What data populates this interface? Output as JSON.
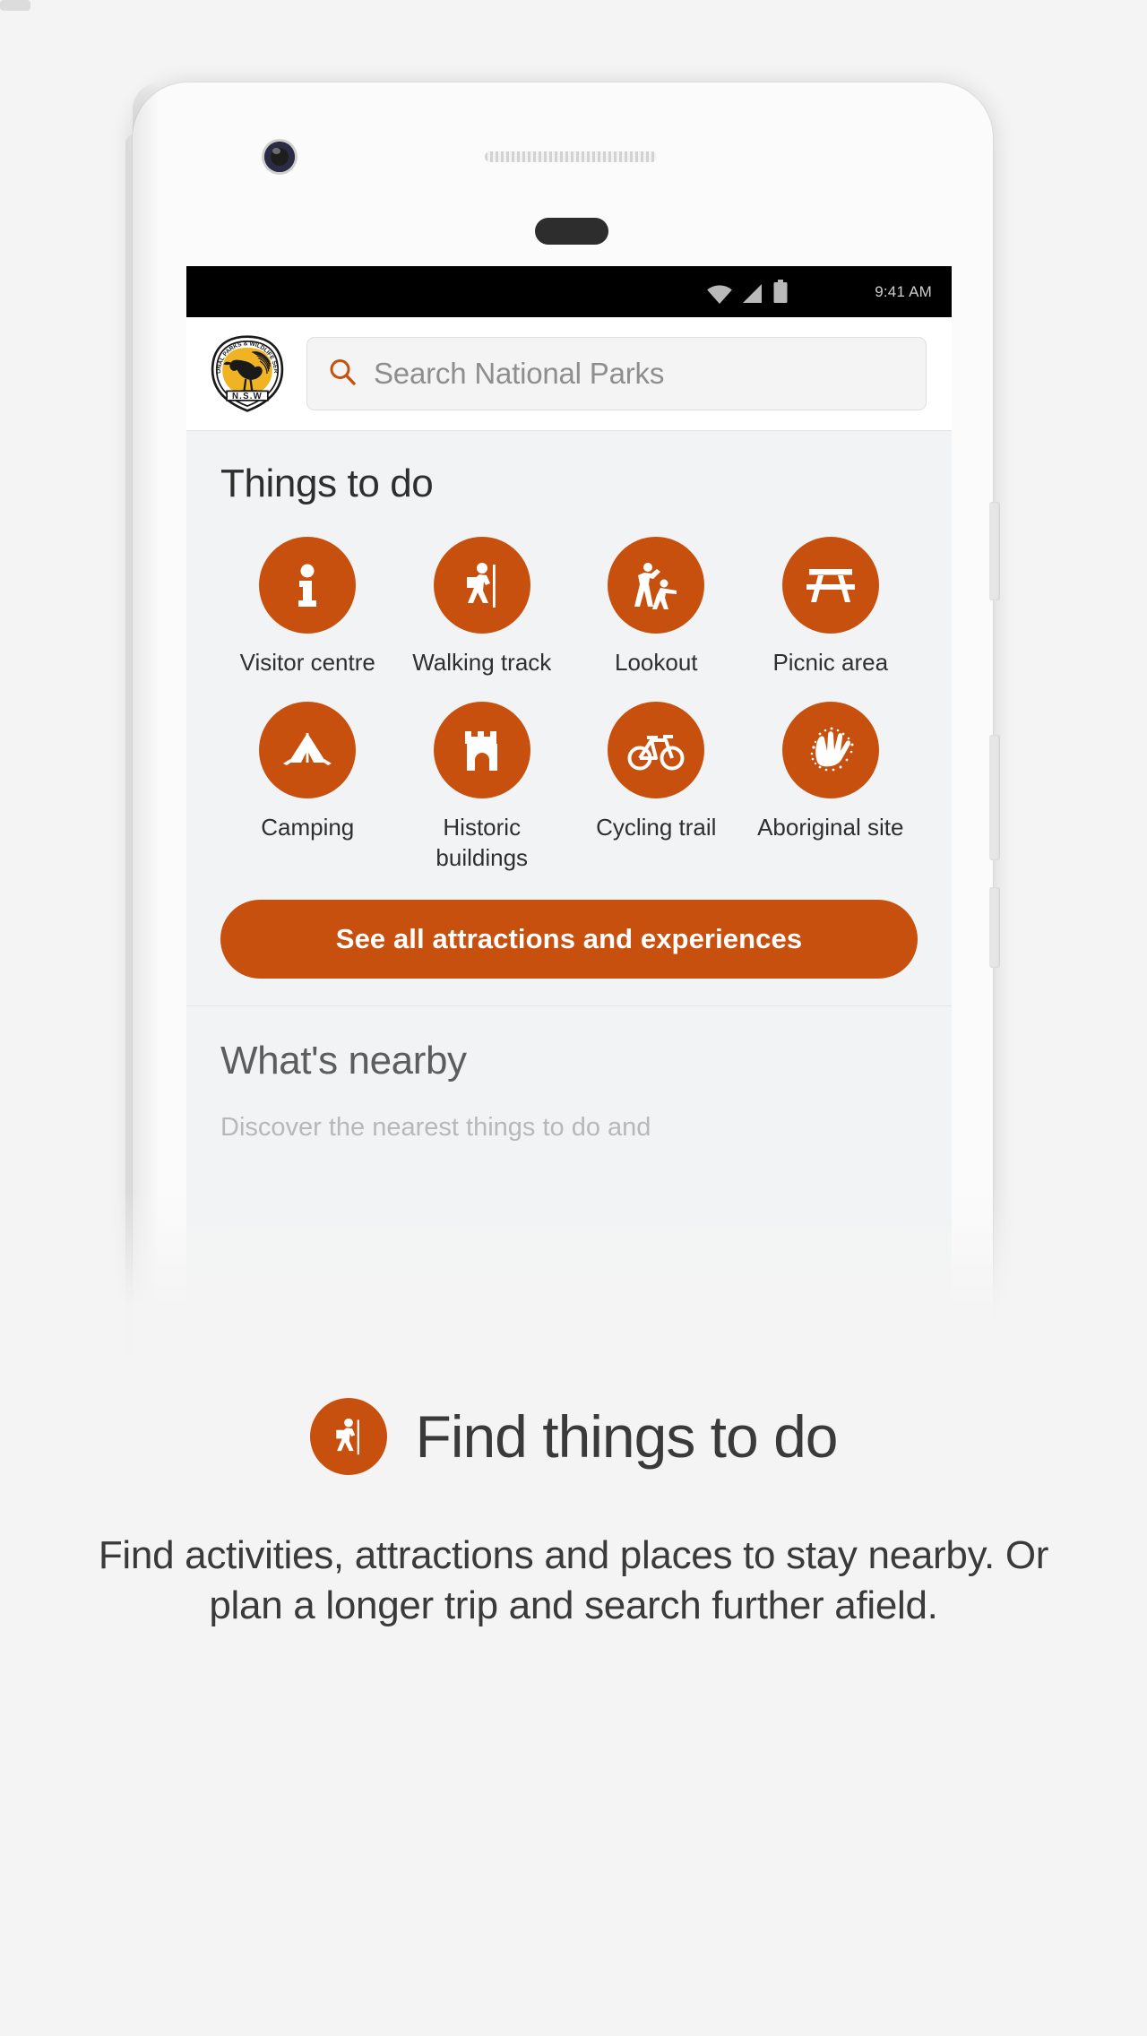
{
  "statusbar": {
    "time": "9:41 AM",
    "icons": [
      "wifi-icon",
      "cell-signal-icon",
      "battery-icon"
    ]
  },
  "header": {
    "logo_alt": "National Parks & Wildlife Service NSW",
    "logo_text_top": "NATIONAL PARKS & WILDLIFE SERVICE",
    "logo_text_bottom": "N S W",
    "search": {
      "placeholder": "Search National Parks",
      "icon": "search-icon"
    }
  },
  "things_to_do": {
    "title": "Things to do",
    "tiles": [
      {
        "label": "Visitor centre",
        "icon": "information-icon"
      },
      {
        "label": "Walking track",
        "icon": "hiker-icon"
      },
      {
        "label": "Lookout",
        "icon": "lookout-icon"
      },
      {
        "label": "Picnic area",
        "icon": "picnic-table-icon"
      },
      {
        "label": "Camping",
        "icon": "tent-icon"
      },
      {
        "label": "Historic\nbuildings",
        "icon": "castle-tower-icon"
      },
      {
        "label": "Cycling trail",
        "icon": "bicycle-icon"
      },
      {
        "label": "Aboriginal\nsite",
        "icon": "aboriginal-hand-stencil-icon"
      }
    ],
    "cta_label": "See all attractions and experiences"
  },
  "nearby": {
    "title": "What's nearby",
    "subtitle": "Discover the nearest things to do and"
  },
  "caption": {
    "icon": "hiker-icon",
    "title": "Find things to do",
    "body": "Find activities, attractions and places to stay nearby. Or plan a longer trip and search further afield."
  },
  "colors": {
    "accent": "#c8500e",
    "page_bg": "#f4f4f4",
    "screen_bg": "#f2f3f4",
    "status_bg": "#000000",
    "logo_gold": "#f0b323"
  }
}
